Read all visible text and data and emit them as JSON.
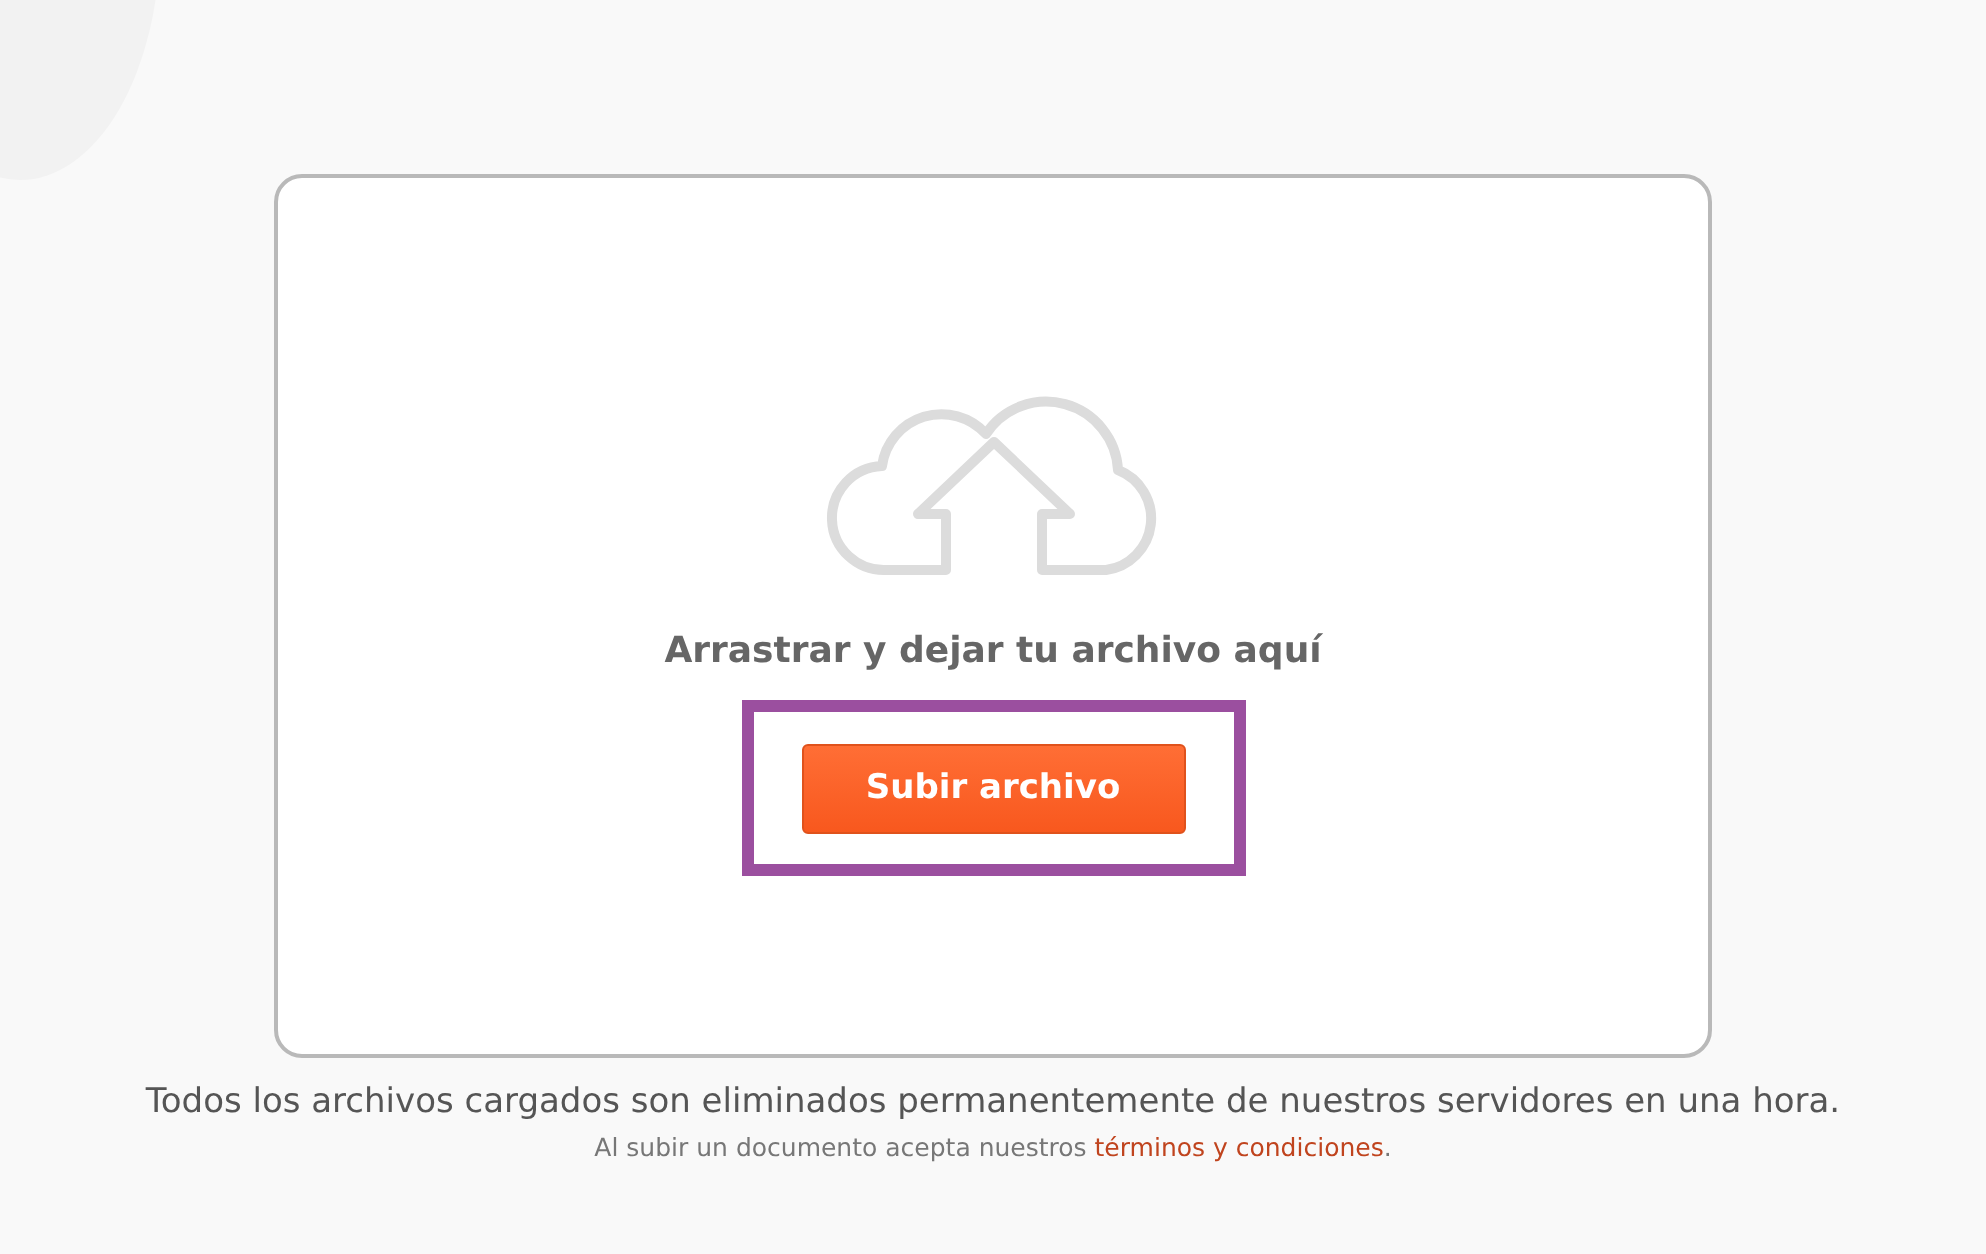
{
  "dropzone": {
    "prompt": "Arrastrar y dejar tu archivo aquí",
    "button": "Subir archivo",
    "highlighted": true
  },
  "footer": {
    "notice": "Todos los archivos cargados son eliminados permanentemente de nuestros servidores en una hora.",
    "terms_prefix": "Al subir un documento acepta nuestros ",
    "terms_link": "términos y condiciones",
    "terms_suffix": "."
  }
}
